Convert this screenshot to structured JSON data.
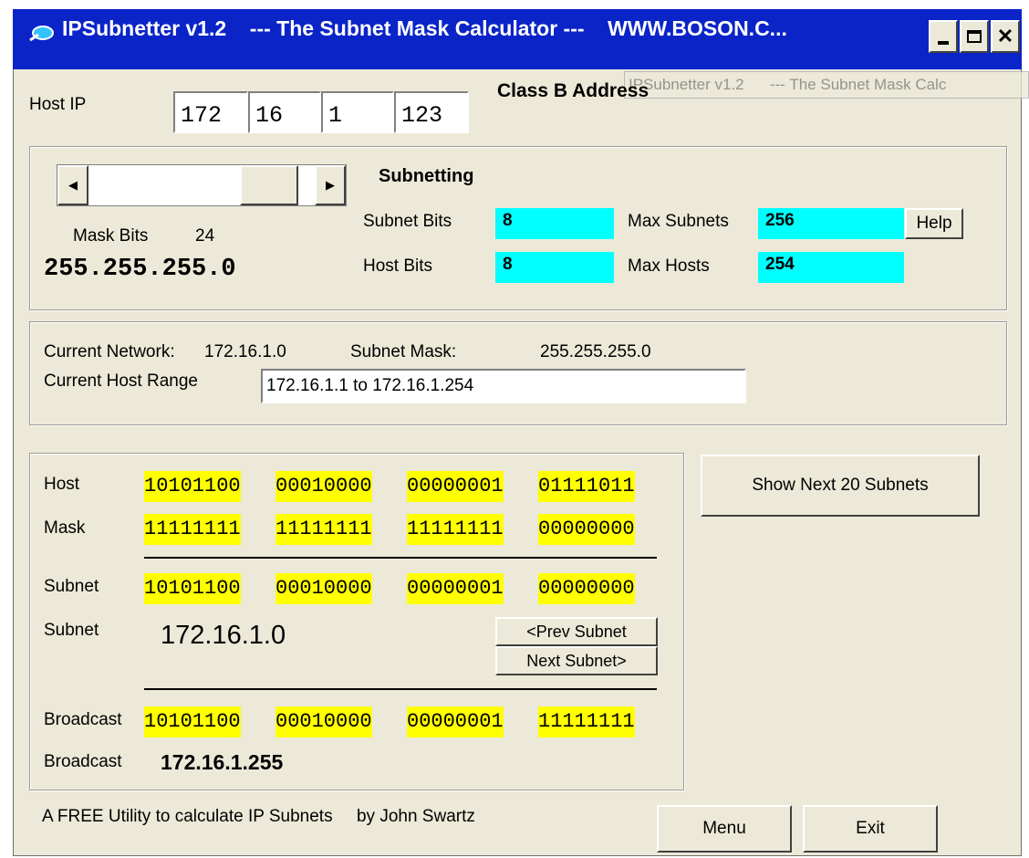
{
  "titlebar": {
    "title": "IPSubnetter v1.2    --- The Subnet Mask Calculator ---    WWW.BOSON.C...",
    "ghost_title": "IPSubnetter v1.2      --- The Subnet Mask Calc"
  },
  "host_ip": {
    "label": "Host IP",
    "octets": [
      "172",
      "16",
      "1",
      "123"
    ],
    "class_label": "Class B Address"
  },
  "subnetting": {
    "heading": "Subnetting",
    "mask_bits_label": "Mask Bits",
    "mask_bits_value": "24",
    "mask_value": "255.255.255.0",
    "subnet_bits_label": "Subnet Bits",
    "subnet_bits_value": "8",
    "host_bits_label": "Host Bits",
    "host_bits_value": "8",
    "max_subnets_label": "Max Subnets",
    "max_subnets_value": "256",
    "max_hosts_label": "Max Hosts",
    "max_hosts_value": "254",
    "help_label": "Help",
    "slider_fraction": 0.9
  },
  "current": {
    "network_label": "Current Network:",
    "network_value": "172.16.1.0",
    "subnet_mask_label": "Subnet Mask:",
    "subnet_mask_value": "255.255.255.0",
    "host_range_label": "Current Host Range",
    "host_range_value": "172.16.1.1 to 172.16.1.254"
  },
  "binary": {
    "host_label": "Host",
    "host": [
      "10101100",
      "00010000",
      "00000001",
      "01111011"
    ],
    "mask_label": "Mask",
    "mask": [
      "11111111",
      "11111111",
      "11111111",
      "00000000"
    ],
    "subnet_label": "Subnet",
    "subnet": [
      "10101100",
      "00010000",
      "00000001",
      "00000000"
    ],
    "subnet_dec_label": "Subnet",
    "subnet_dec": "172.16.1.0",
    "prev_subnet": "<Prev Subnet",
    "next_subnet": "Next Subnet>",
    "broadcast_label": "Broadcast",
    "broadcast": [
      "10101100",
      "00010000",
      "00000001",
      "11111111"
    ],
    "broadcast_dec_label": "Broadcast",
    "broadcast_dec": "172.16.1.255"
  },
  "show_next_label": "Show Next 20 Subnets",
  "footer": {
    "credit": "A FREE Utility to calculate IP Subnets     by John Swartz",
    "menu": "Menu",
    "exit": "Exit"
  },
  "colors": {
    "titlebar": "#0a24c8",
    "cyan": "#00ffff",
    "yellow": "#ffff00",
    "face": "#ece9d8"
  }
}
